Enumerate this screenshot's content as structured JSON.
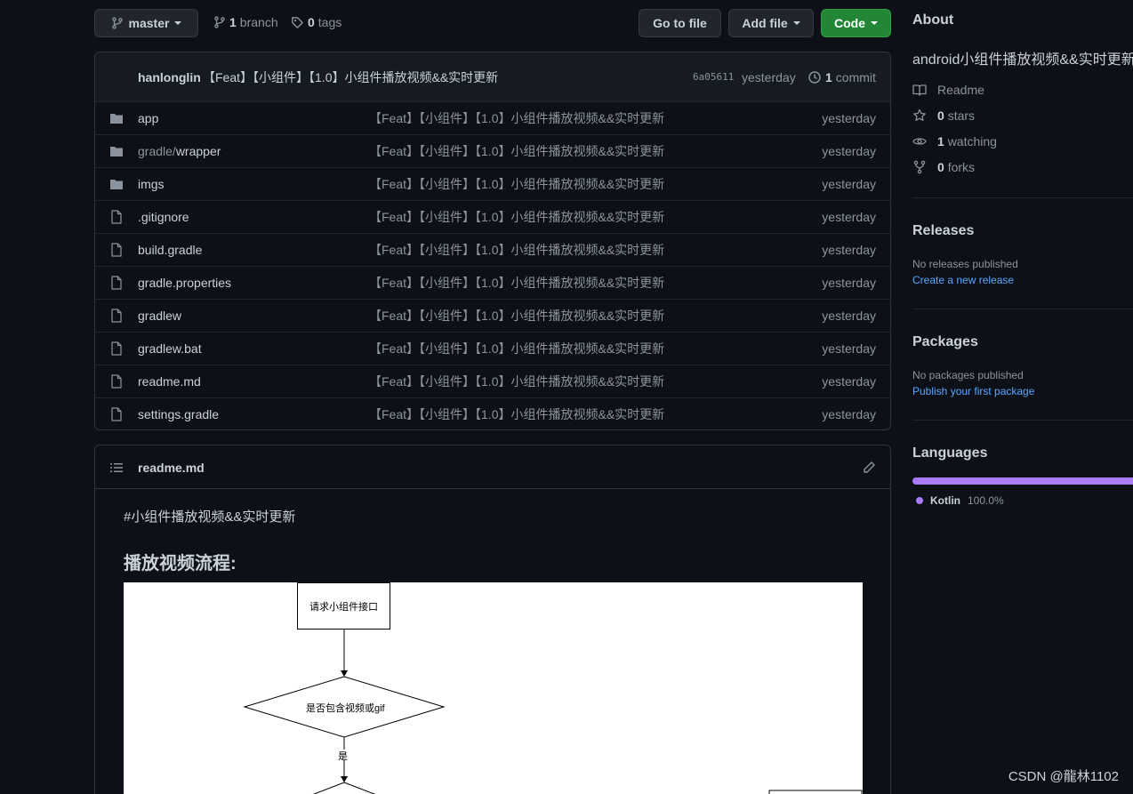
{
  "toolbar": {
    "branch_name": "master",
    "branch_count": "1",
    "branch_label": "branch",
    "tag_count": "0",
    "tag_label": "tags",
    "go_to_file": "Go to file",
    "add_file": "Add file",
    "code": "Code"
  },
  "commit": {
    "author": "hanlonglin",
    "message": "【Feat】【小组件】【1.0】小组件播放视频&&实时更新",
    "sha": "6a05611",
    "time": "yesterday",
    "count": "1",
    "count_label": "commit"
  },
  "files": [
    {
      "name": "app",
      "type": "folder",
      "message": "【Feat】【小组件】【1.0】小组件播放视频&&实时更新",
      "time": "yesterday"
    },
    {
      "name_prefix": "gradle/",
      "name": "wrapper",
      "type": "folder",
      "message": "【Feat】【小组件】【1.0】小组件播放视频&&实时更新",
      "time": "yesterday"
    },
    {
      "name": "imgs",
      "type": "folder",
      "message": "【Feat】【小组件】【1.0】小组件播放视频&&实时更新",
      "time": "yesterday"
    },
    {
      "name": ".gitignore",
      "type": "file",
      "message": "【Feat】【小组件】【1.0】小组件播放视频&&实时更新",
      "time": "yesterday"
    },
    {
      "name": "build.gradle",
      "type": "file",
      "message": "【Feat】【小组件】【1.0】小组件播放视频&&实时更新",
      "time": "yesterday"
    },
    {
      "name": "gradle.properties",
      "type": "file",
      "message": "【Feat】【小组件】【1.0】小组件播放视频&&实时更新",
      "time": "yesterday"
    },
    {
      "name": "gradlew",
      "type": "file",
      "message": "【Feat】【小组件】【1.0】小组件播放视频&&实时更新",
      "time": "yesterday"
    },
    {
      "name": "gradlew.bat",
      "type": "file",
      "message": "【Feat】【小组件】【1.0】小组件播放视频&&实时更新",
      "time": "yesterday"
    },
    {
      "name": "readme.md",
      "type": "file",
      "message": "【Feat】【小组件】【1.0】小组件播放视频&&实时更新",
      "time": "yesterday"
    },
    {
      "name": "settings.gradle",
      "type": "file",
      "message": "【Feat】【小组件】【1.0】小组件播放视频&&实时更新",
      "time": "yesterday"
    }
  ],
  "readme": {
    "filename": "readme.md",
    "line1": "#小组件播放视频&&实时更新",
    "heading": "播放视频流程:",
    "flow": {
      "step1": "请求小组件接口",
      "decision": "是否包含视频或gif",
      "yes": "是"
    }
  },
  "about": {
    "title": "About",
    "description": "android小组件播放视频&&实时更新",
    "readme": "Readme",
    "stars_count": "0",
    "stars_label": "stars",
    "watching_count": "1",
    "watching_label": "watching",
    "forks_count": "0",
    "forks_label": "forks"
  },
  "releases": {
    "title": "Releases",
    "empty": "No releases published",
    "link": "Create a new release"
  },
  "packages": {
    "title": "Packages",
    "empty": "No packages published",
    "link": "Publish your first package"
  },
  "languages": {
    "title": "Languages",
    "items": [
      {
        "name": "Kotlin",
        "percent": "100.0%",
        "color": "#a97bff",
        "share": 1.0
      }
    ]
  },
  "watermark": "CSDN @龍林1102",
  "colors": {
    "accent": "#238636",
    "link": "#58a6ff",
    "kotlin": "#a97bff"
  }
}
